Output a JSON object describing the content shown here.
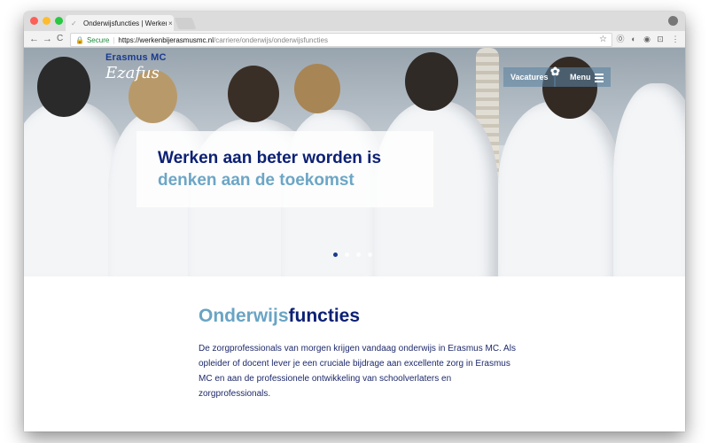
{
  "browser": {
    "tab_title": "Onderwijsfuncties | Werken bij",
    "tab_close": "×",
    "url_secure_label": "Secure",
    "url_host": "https://werkenbijerasmusmc.nl",
    "url_path": "/carriere/onderwijs/onderwijsfuncties",
    "back": "←",
    "forward": "→",
    "reload": "C",
    "star": "☆",
    "ext_icons": [
      "⓪",
      "◐",
      "◉",
      "⊡",
      "⋮"
    ]
  },
  "site": {
    "logo_title": "Erasmus MC",
    "logo_script": "Ezafus",
    "nav_vacatures": "Vacatures",
    "nav_menu": "Menu",
    "flower": "✿"
  },
  "hero": {
    "headline_line1": "Werken aan beter worden is",
    "headline_line2": "denken aan de toekomst",
    "slide_count": 4,
    "active_slide": 1
  },
  "content": {
    "heading_part1": "Onderwijs",
    "heading_part2": "functies",
    "body": "De zorgprofessionals van morgen krijgen vandaag onderwijs in Erasmus MC. Als opleider of docent lever je een cruciale bijdrage aan excellente zorg in Erasmus MC en aan de professionele ontwikkeling van schoolverlaters en zorgprofessionals."
  },
  "colors": {
    "navy": "#0c2074",
    "light_blue": "#6aa4c4",
    "secure_green": "#1c8a3c"
  }
}
